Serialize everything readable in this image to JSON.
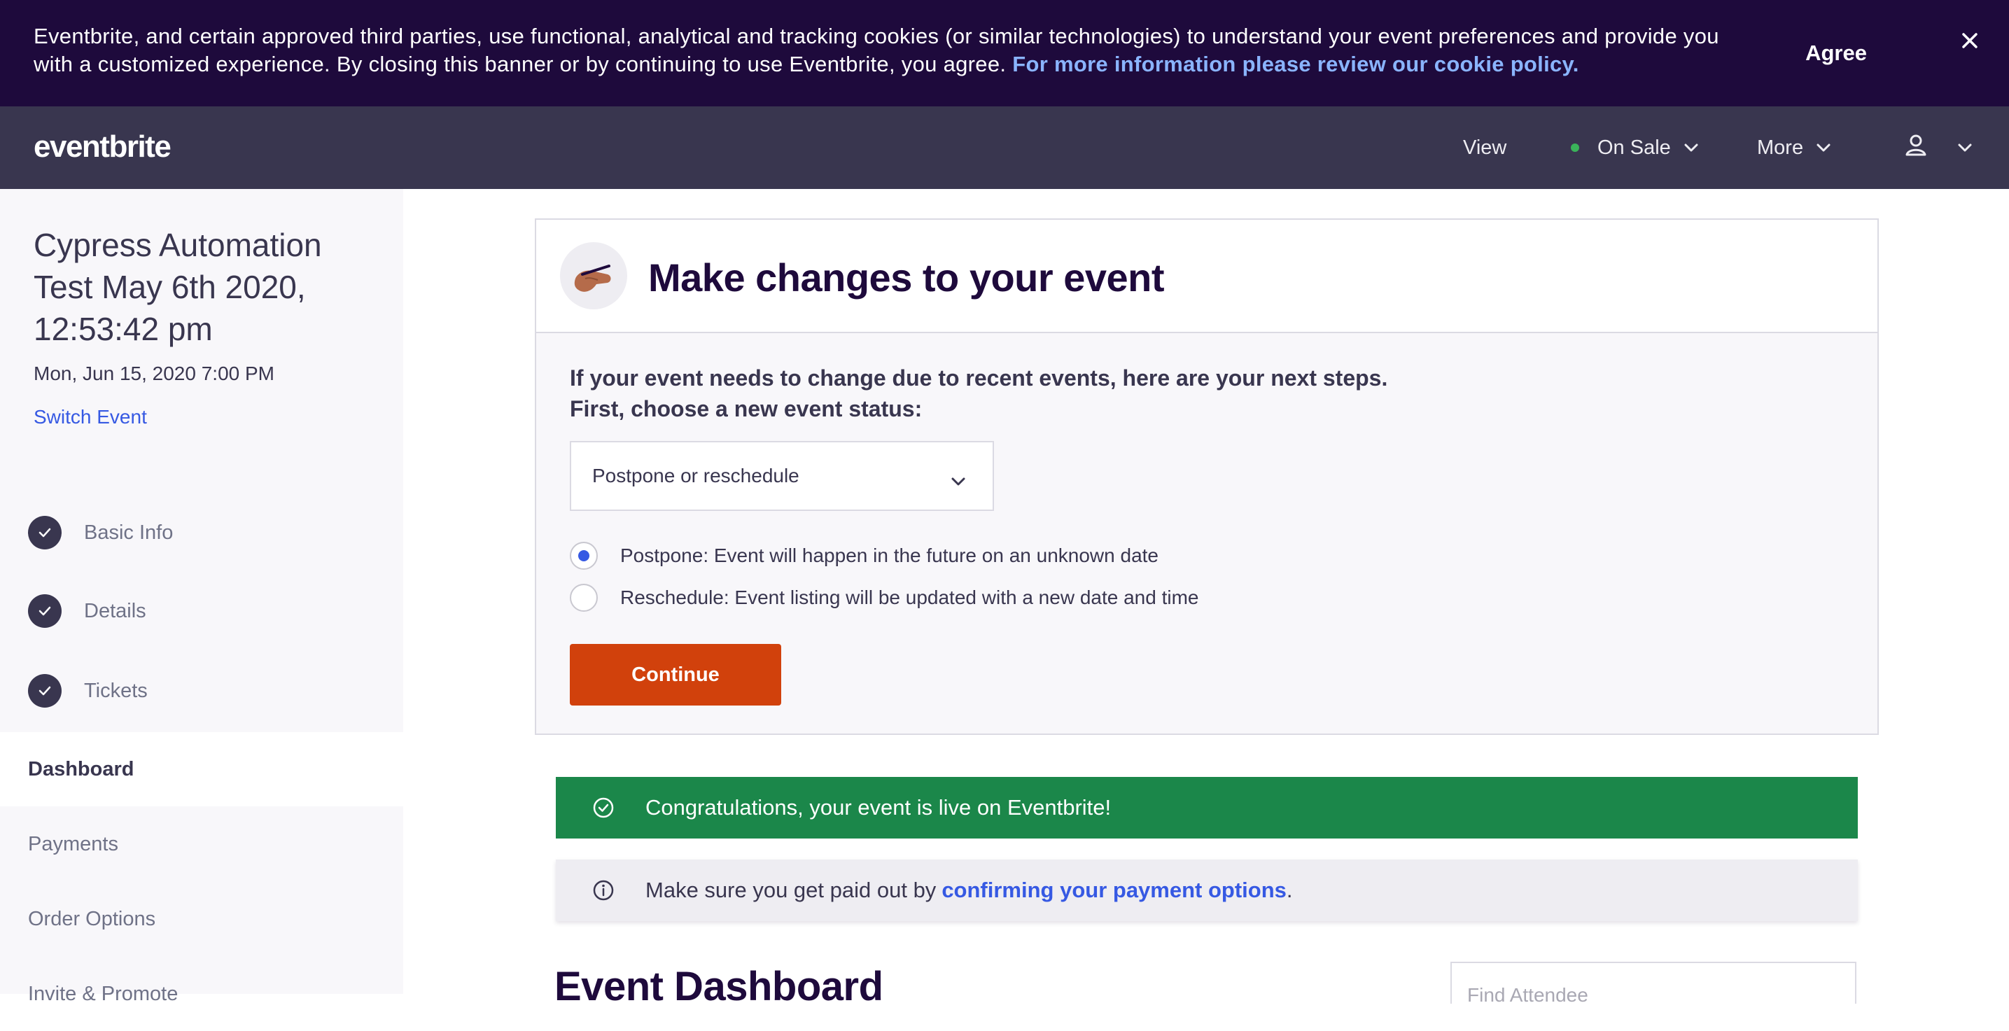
{
  "cookie_banner": {
    "text": "Eventbrite, and certain approved third parties, use functional, analytical and tracking cookies (or similar technologies) to understand your event preferences and provide you with a customized experience. By closing this banner or by continuing to use Eventbrite, you agree.",
    "link": "For more information please review our cookie policy.",
    "agree_label": "Agree",
    "close_icon": "close-icon"
  },
  "nav": {
    "logo": "eventbrite",
    "view_label": "View",
    "status_label": "On Sale",
    "more_label": "More",
    "user_icon": "user-icon"
  },
  "sidebar": {
    "event_title": "Cypress Automation Test May 6th 2020, 12:53:42 pm",
    "event_date": "Mon, Jun 15, 2020 7:00 PM",
    "switch_event": "Switch Event",
    "steps": [
      {
        "label": "Basic Info",
        "done": true
      },
      {
        "label": "Details",
        "done": true
      },
      {
        "label": "Tickets",
        "done": true
      }
    ],
    "links": [
      {
        "label": "Dashboard",
        "active": true
      },
      {
        "label": "Payments"
      },
      {
        "label": "Order Options"
      },
      {
        "label": "Invite & Promote"
      }
    ]
  },
  "change_card": {
    "title": "Make changes to your event",
    "intro_line1": "If your event needs to change due to recent events, here are your next steps.",
    "intro_line2": "First, choose a new event status:",
    "select_value": "Postpone or reschedule",
    "options": [
      {
        "label": "Postpone: Event will happen in the future on an unknown date",
        "checked": true
      },
      {
        "label": "Reschedule: Event listing will be updated with a new date and time",
        "checked": false
      }
    ],
    "continue_label": "Continue"
  },
  "alerts": {
    "success": "Congratulations, your event is live on Eventbrite!",
    "info_prefix": "Make sure you get paid out by",
    "info_link": "confirming your payment options",
    "info_suffix": "."
  },
  "dashboard": {
    "title": "Event Dashboard",
    "search_placeholder": "Find Attendee"
  },
  "colors": {
    "banner_bg": "#1e0a3c",
    "nav_bg": "#39364f",
    "accent_orange": "#d1410c",
    "success_green": "#1b874a",
    "link_blue": "#3659e3"
  }
}
